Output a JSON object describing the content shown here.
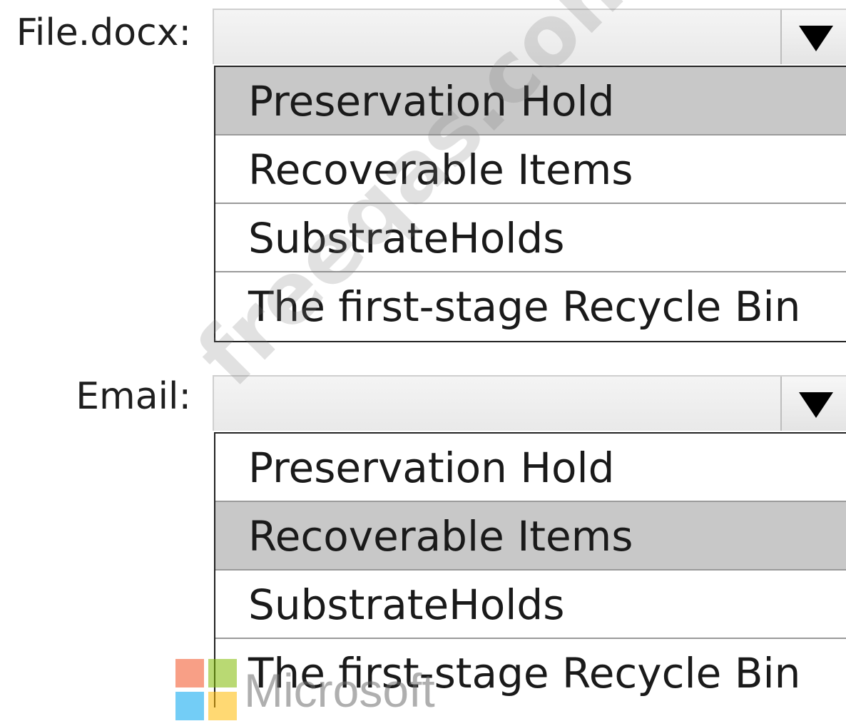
{
  "fields": [
    {
      "label": "File.docx:",
      "selected_value": "",
      "options": [
        "Preservation Hold",
        "Recoverable Items",
        "SubstrateHolds",
        "The first-stage Recycle Bin"
      ],
      "highlighted": "Preservation Hold"
    },
    {
      "label": "Email:",
      "selected_value": "",
      "options": [
        "Preservation Hold",
        "Recoverable Items",
        "SubstrateHolds",
        "The first-stage Recycle Bin"
      ],
      "highlighted": "Recoverable Items"
    }
  ],
  "watermark": "freeqas.com",
  "logo": {
    "text": "Microsoft",
    "colors": [
      "#f25022",
      "#7fba00",
      "#00a4ef",
      "#ffb900"
    ]
  },
  "icons": {
    "dropdown": "chevron-down-icon"
  }
}
